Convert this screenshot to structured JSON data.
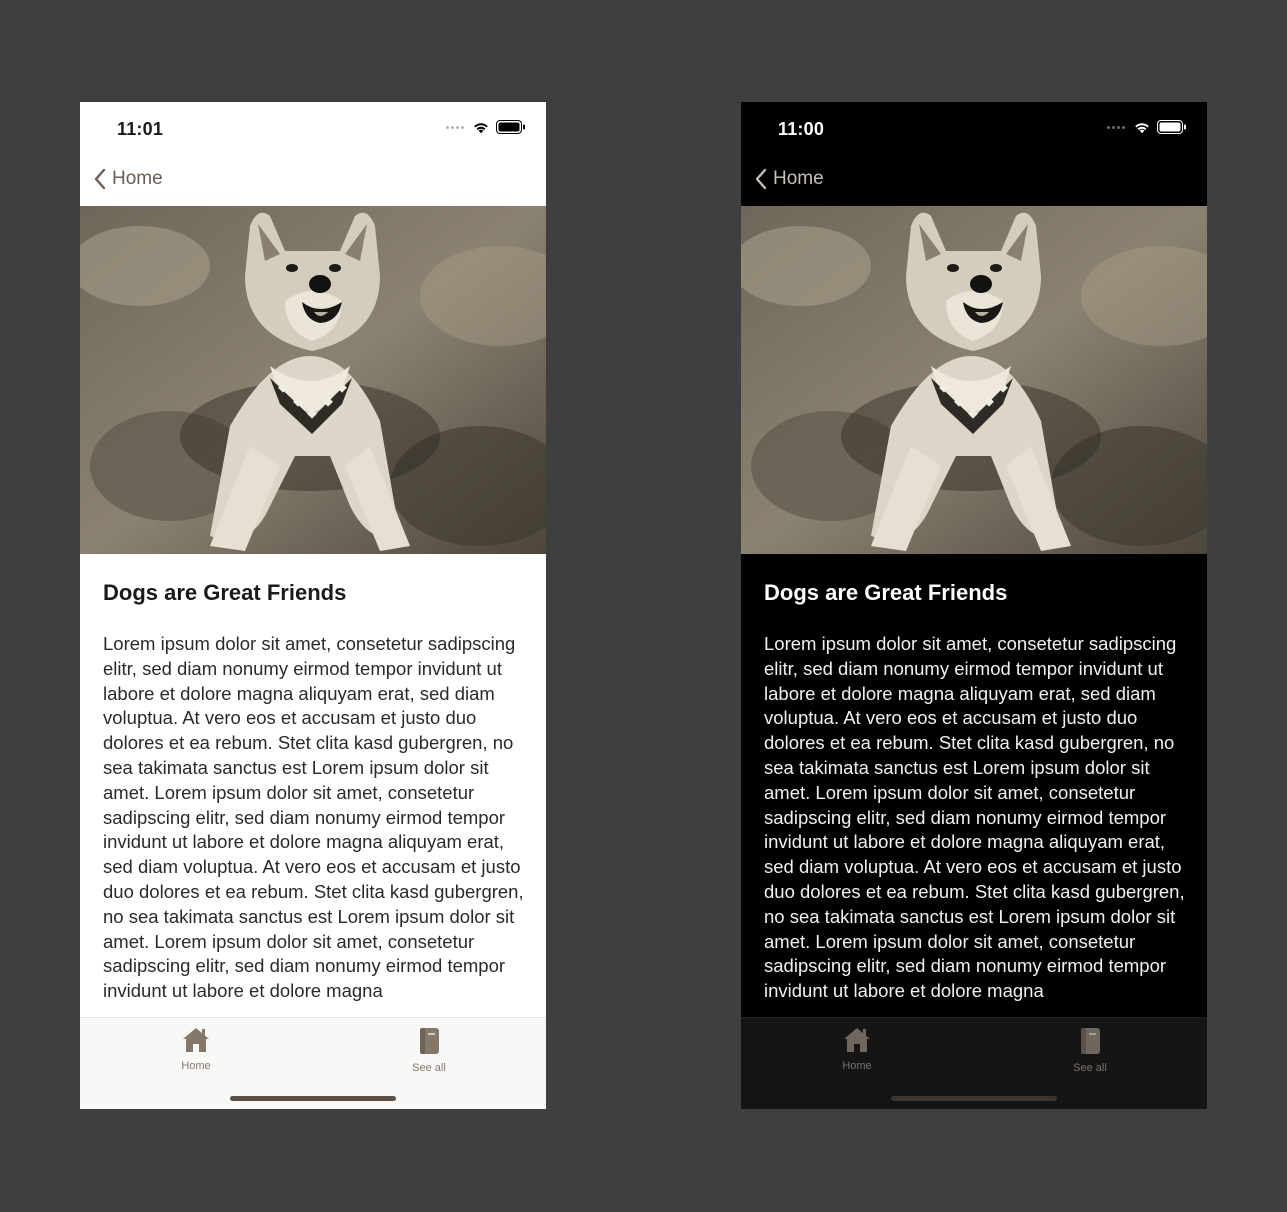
{
  "colors": {
    "canvas_bg": "#3f3f3f",
    "light_bg": "#ffffff",
    "dark_bg": "#000000",
    "accent_brown": "#6b5e52",
    "tab_tint": "#857869"
  },
  "light": {
    "status": {
      "time": "11:01"
    },
    "nav": {
      "back_label": "Home"
    },
    "article": {
      "title": "Dogs are Great Friends",
      "body": "Lorem ipsum dolor sit amet, consetetur sadipscing elitr, sed diam nonumy eirmod tempor invidunt ut labore et dolore magna aliquyam erat, sed diam voluptua. At vero eos et accusam et justo duo dolores et ea rebum. Stet clita kasd gubergren, no sea takimata sanctus est Lorem ipsum dolor sit amet. Lorem ipsum dolor sit amet, consetetur sadipscing elitr, sed diam nonumy eirmod tempor invidunt ut labore et dolore magna aliquyam erat, sed diam voluptua. At vero eos et accusam et justo duo dolores et ea rebum. Stet clita kasd gubergren, no sea takimata sanctus est Lorem ipsum dolor sit amet. Lorem ipsum dolor sit amet, consetetur sadipscing elitr, sed diam nonumy eirmod tempor invidunt ut labore et dolore magna"
    },
    "tabs": [
      {
        "label": "Home",
        "icon": "house-icon"
      },
      {
        "label": "See all",
        "icon": "book-icon"
      }
    ]
  },
  "dark": {
    "status": {
      "time": "11:00"
    },
    "nav": {
      "back_label": "Home"
    },
    "article": {
      "title": "Dogs are Great Friends",
      "body": "Lorem ipsum dolor sit amet, consetetur sadipscing elitr, sed diam nonumy eirmod tempor invidunt ut labore et dolore magna aliquyam erat, sed diam voluptua. At vero eos et accusam et justo duo dolores et ea rebum. Stet clita kasd gubergren, no sea takimata sanctus est Lorem ipsum dolor sit amet. Lorem ipsum dolor sit amet, consetetur sadipscing elitr, sed diam nonumy eirmod tempor invidunt ut labore et dolore magna aliquyam erat, sed diam voluptua. At vero eos et accusam et justo duo dolores et ea rebum. Stet clita kasd gubergren, no sea takimata sanctus est Lorem ipsum dolor sit amet. Lorem ipsum dolor sit amet, consetetur sadipscing elitr, sed diam nonumy eirmod tempor invidunt ut labore et dolore magna"
    },
    "tabs": [
      {
        "label": "Home",
        "icon": "house-icon"
      },
      {
        "label": "See all",
        "icon": "book-icon"
      }
    ]
  }
}
